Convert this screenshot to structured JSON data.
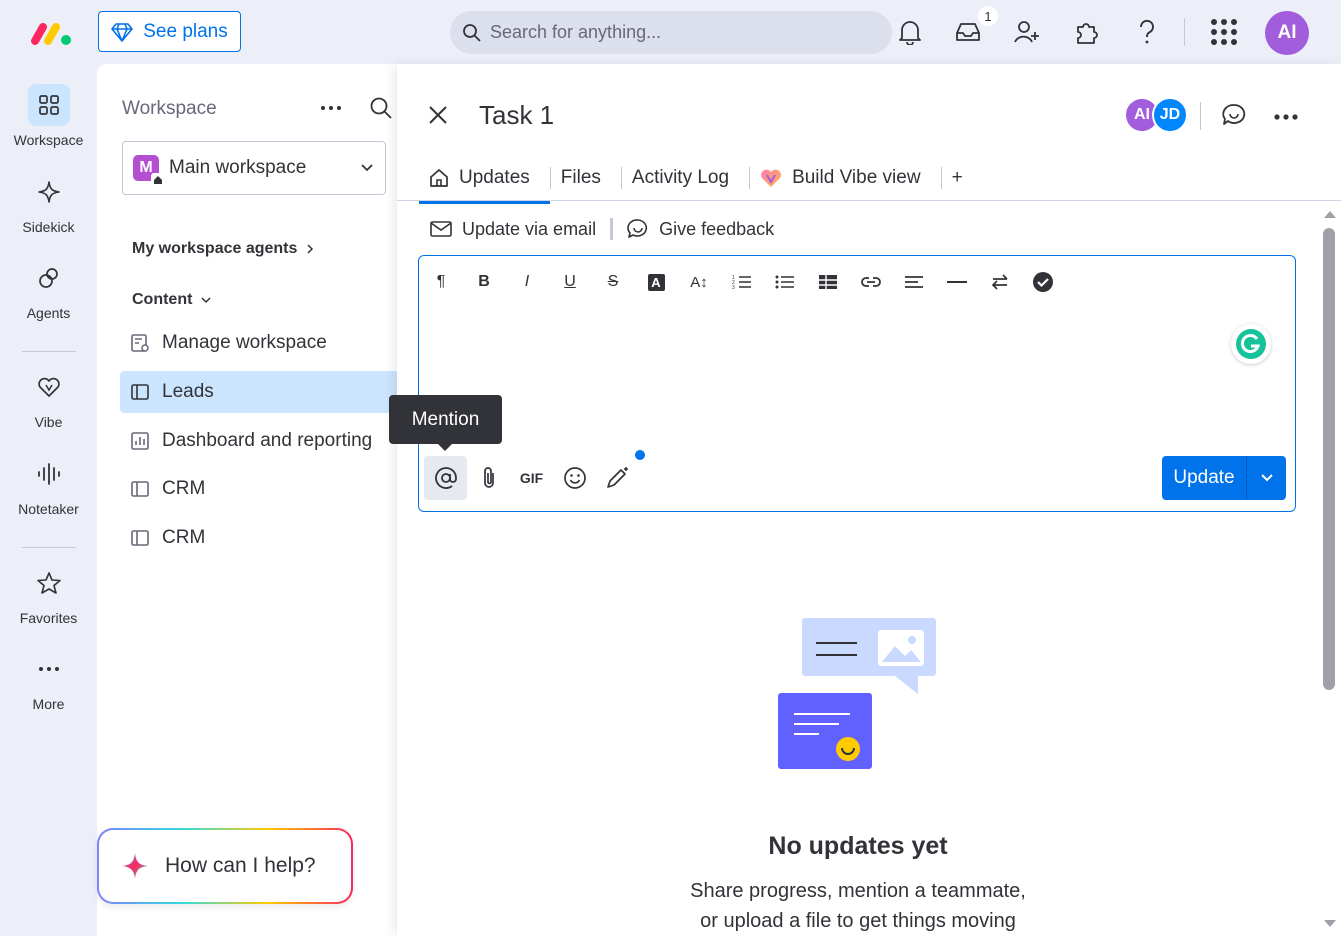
{
  "topbar": {
    "see_plans": "See plans",
    "search_placeholder": "Search for anything...",
    "inbox_badge": "1",
    "avatar_initials": "AI"
  },
  "rail": {
    "items": [
      {
        "label": "Workspace",
        "icon": "grid-icon"
      },
      {
        "label": "Sidekick",
        "icon": "sparkle-icon"
      },
      {
        "label": "Agents",
        "icon": "agents-icon"
      },
      {
        "label": "Vibe",
        "icon": "heart-icon"
      },
      {
        "label": "Notetaker",
        "icon": "waveform-icon"
      },
      {
        "label": "Favorites",
        "icon": "star-icon"
      },
      {
        "label": "More",
        "icon": "more-dots-icon"
      }
    ]
  },
  "sidebar": {
    "title": "Workspace",
    "workspace_mark": "M",
    "workspace_name": "Main workspace",
    "agents_label": "My workspace agents",
    "content_label": "Content",
    "items": [
      {
        "label": "Manage workspace",
        "icon": "manage-icon"
      },
      {
        "label": "Leads",
        "icon": "board-icon"
      },
      {
        "label": "Dashboard and reporting",
        "icon": "dashboard-icon"
      },
      {
        "label": "CRM",
        "icon": "board-icon"
      },
      {
        "label": "CRM",
        "icon": "board-icon"
      }
    ],
    "help": "How can I help?"
  },
  "panel": {
    "title": "Task 1",
    "avatars": [
      {
        "initials": "AI",
        "color": "#a25ddc"
      },
      {
        "initials": "JD",
        "color": "#0086ff"
      }
    ],
    "tabs": [
      {
        "label": "Updates"
      },
      {
        "label": "Files"
      },
      {
        "label": "Activity Log"
      },
      {
        "label": "Build Vibe view"
      }
    ],
    "add_tab": "+",
    "update_via_email": "Update via email",
    "give_feedback": "Give feedback",
    "gif_label": "GIF",
    "update_button": "Update",
    "tooltip": "Mention",
    "empty_title": "No updates yet",
    "empty_line1": "Share progress, mention a teammate,",
    "empty_line2": "or upload a file to get things moving"
  },
  "colors": {
    "accent": "#0073ea",
    "selected": "#cce5ff",
    "illustration_purple": "#6161ff",
    "illustration_light": "#c9d9ff"
  }
}
